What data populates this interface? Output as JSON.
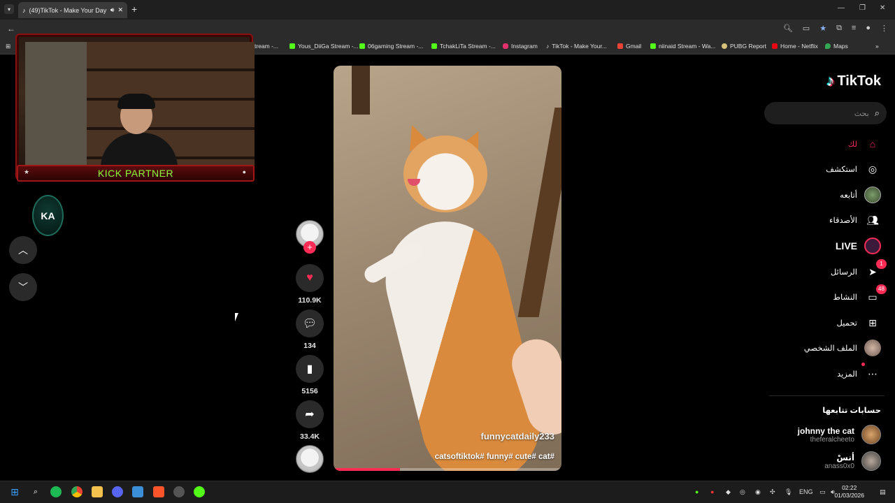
{
  "browser": {
    "tab_title": "(49)TikTok - Make Your Day",
    "bookmarks": [
      "tream -...",
      "Yous_DiiGa Stream -...",
      "06gaming Stream -...",
      "TchakLiTa Stream -...",
      "Instagram",
      "TikTok - Make Your...",
      "Gmail",
      "niinaid Stream - Wa...",
      "PUBG Report",
      "Home - Netflix",
      "Maps"
    ]
  },
  "overlay": {
    "banner": "KICK PARTNER",
    "logo_text": "KA"
  },
  "video": {
    "author": "funnycatdaily233",
    "tags": "catsoftiktok# funny# cute# cat#",
    "progress": 0.29
  },
  "actions": {
    "likes": "110.9K",
    "comments": "134",
    "saves": "5156",
    "shares": "33.4K"
  },
  "sidebar": {
    "logo": "TikTok",
    "search_placeholder": "بحث",
    "nav": [
      {
        "label": "لك",
        "icon": "home-icon"
      },
      {
        "label": "استكشف",
        "icon": "compass-icon"
      },
      {
        "label": "أتابعه",
        "icon": "following-avatar"
      },
      {
        "label": "الأصدقاء",
        "icon": "friends-icon"
      },
      {
        "label": "LIVE",
        "icon": "live-icon"
      },
      {
        "label": "الرسائل",
        "icon": "send-icon",
        "badge": "1"
      },
      {
        "label": "النشاط",
        "icon": "inbox-icon",
        "badge": "48"
      },
      {
        "label": "تحميل",
        "icon": "upload-icon"
      },
      {
        "label": "الملف الشخصي",
        "icon": "profile-avatar"
      },
      {
        "label": "المزيد",
        "icon": "more-icon"
      }
    ],
    "following_title": "حسابات تتابعها",
    "accounts": [
      {
        "name": "johnny the cat",
        "handle": "theferalcheeto"
      },
      {
        "name": "أنسْ",
        "handle": "anass0x0"
      }
    ]
  },
  "taskbar": {
    "lang": "ENG",
    "time": "02:22",
    "date": "01/03/2026"
  },
  "colors": {
    "accent": "#fe2c55",
    "kick_green": "#8dff3c"
  }
}
